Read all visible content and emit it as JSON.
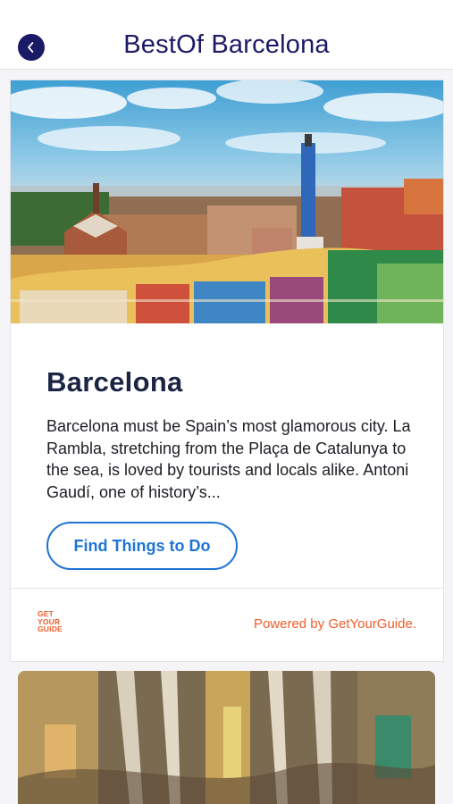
{
  "header": {
    "title": "BestOf Barcelona"
  },
  "card": {
    "title": "Barcelona",
    "description": "Barcelona must be Spain’s most glamorous city. La Rambla, stretching from the Plaça de Catalunya to the sea, is loved by tourists and locals alike. Antoni Gaudí, one of history’s...",
    "cta_label": "Find Things to Do",
    "logo_line1": "GET",
    "logo_line2": "YOUR",
    "logo_line3": "GUIDE",
    "powered_text": "Powered by GetYourGuide."
  },
  "colors": {
    "brand_navy": "#1b1a66",
    "cta_blue": "#1e73d7",
    "gyg_orange": "#f25c2b"
  },
  "icons": {
    "back": "chevron-left-icon"
  }
}
